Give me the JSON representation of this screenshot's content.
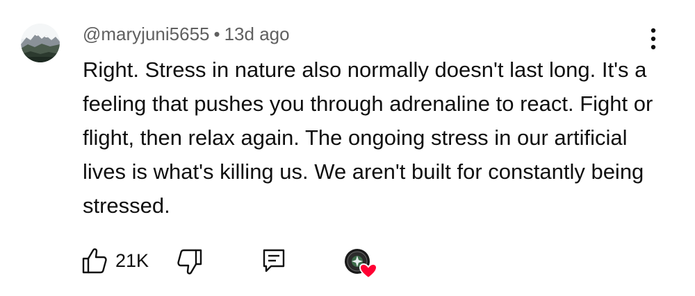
{
  "comment": {
    "author": "@maryjuni5655",
    "separator": "•",
    "age": "13d ago",
    "text": "Right. Stress in nature also normally doesn't last long. It's a feeling that pushes you through adrenaline to react. Fight or flight, then relax again. The ongoing stress in our artificial lives is what's killing us. We aren't built for constantly being stressed."
  },
  "actions": {
    "like_count": "21K"
  },
  "icons": {
    "avatar": "mountain-landscape-avatar",
    "menu": "more-vert-icon",
    "like": "thumbs-up-icon",
    "dislike": "thumbs-down-icon",
    "reply": "comment-reply-icon",
    "creator_heart": "creator-heart-icon"
  },
  "colors": {
    "text_primary": "#0f0f0f",
    "text_secondary": "#606060",
    "heart_red": "#ff0033"
  }
}
